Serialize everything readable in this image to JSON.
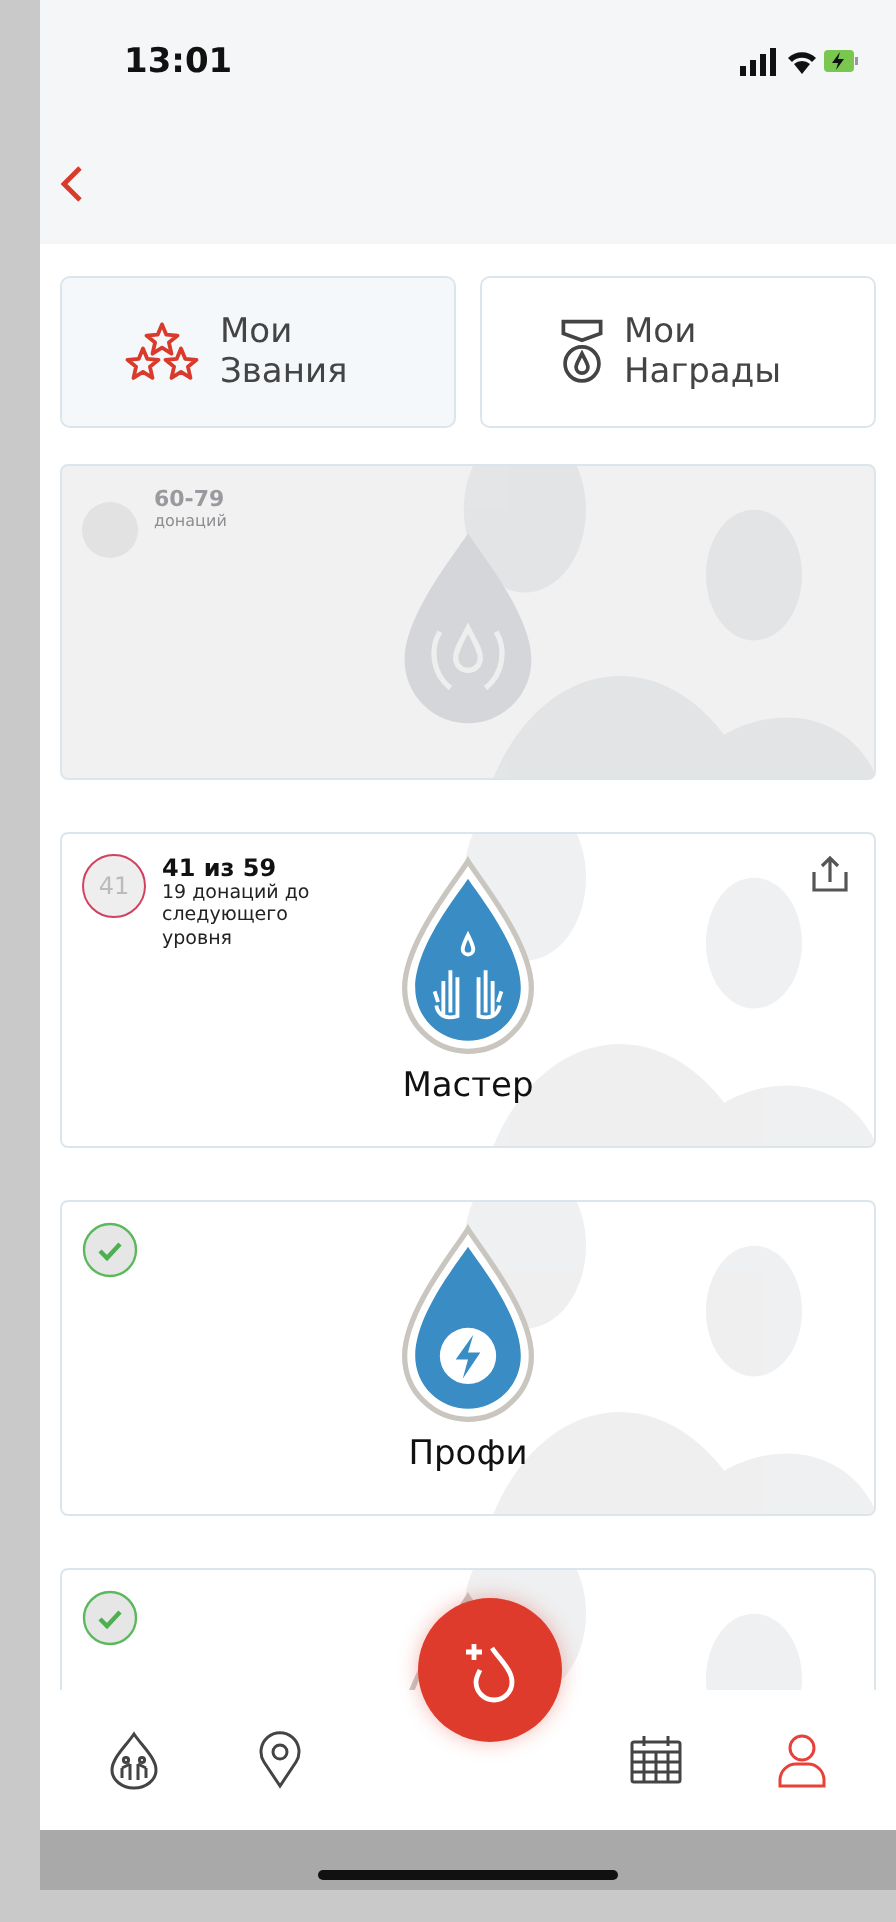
{
  "status_bar": {
    "time": "13:01"
  },
  "tabs": [
    {
      "label": "Мои Звания",
      "selected": true
    },
    {
      "label": "Мои Награды",
      "selected": false
    }
  ],
  "ranks": [
    {
      "kind": "locked",
      "range": "60-79",
      "unit": "донаций"
    },
    {
      "kind": "current",
      "badge": "41",
      "progress": "41 из 59",
      "subtitle": "19 донаций до следующего уровня",
      "name": "Мастер"
    },
    {
      "kind": "achieved",
      "name": "Профи"
    },
    {
      "kind": "achieved"
    }
  ],
  "nav": [
    {
      "selected": false
    },
    {
      "selected": false
    },
    {
      "selected": false
    },
    {
      "selected": true
    }
  ]
}
